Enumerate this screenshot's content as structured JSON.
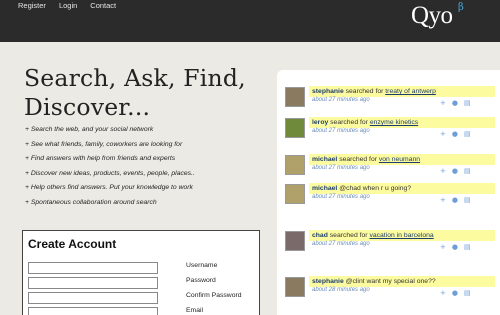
{
  "nav": {
    "register": "Register",
    "login": "Login",
    "contact": "Contact"
  },
  "logo": {
    "text": "Qyo",
    "beta": "β"
  },
  "headline": {
    "line1": "Search, Ask, Find,",
    "line2": "Discover..."
  },
  "features": [
    "+ Search the web, and your social network",
    "+ See what friends, family, coworkers are looking for",
    "+ Find answers with help from friends and experts",
    "+ Discover new ideas, products, events, people, places..",
    "+ Help others find answers. Put your knowledge to work",
    "+ Spontaneous collaboration around search"
  ],
  "account": {
    "title": "Create Account",
    "fields": [
      "Username",
      "Password",
      "Confirm Password",
      "Email"
    ]
  },
  "feed": [
    {
      "user": "stephanie",
      "verb": "searched for",
      "query": "treaty of antwerp",
      "time": "about 27 minutes ago",
      "avatar_color": "#8a7a60"
    },
    {
      "user": "leroy",
      "verb": "searched for",
      "query": "enzyme kinetics",
      "time": "about 27 minutes ago",
      "avatar_color": "#6f8a3a"
    },
    {
      "user": "michael",
      "verb": "searched for",
      "query": "von neumann",
      "time": "about 27 minutes ago",
      "avatar_color": "#b0a06a"
    },
    {
      "user": "michael",
      "verb": "@chad when r u going?",
      "query": "",
      "time": "about 27 minutes ago",
      "avatar_color": "#b0a06a"
    },
    {
      "user": "chad",
      "verb": "searched for",
      "query": "vacation in barcelona",
      "time": "about 27 minutes ago",
      "avatar_color": "#7a6a6a"
    },
    {
      "user": "stephanie",
      "verb": "@clint want my special one??",
      "query": "",
      "time": "about 28 minutes ago",
      "avatar_color": "#8a7a60"
    }
  ],
  "icons": {
    "reply": "+",
    "comment": "●",
    "page": "▤"
  }
}
